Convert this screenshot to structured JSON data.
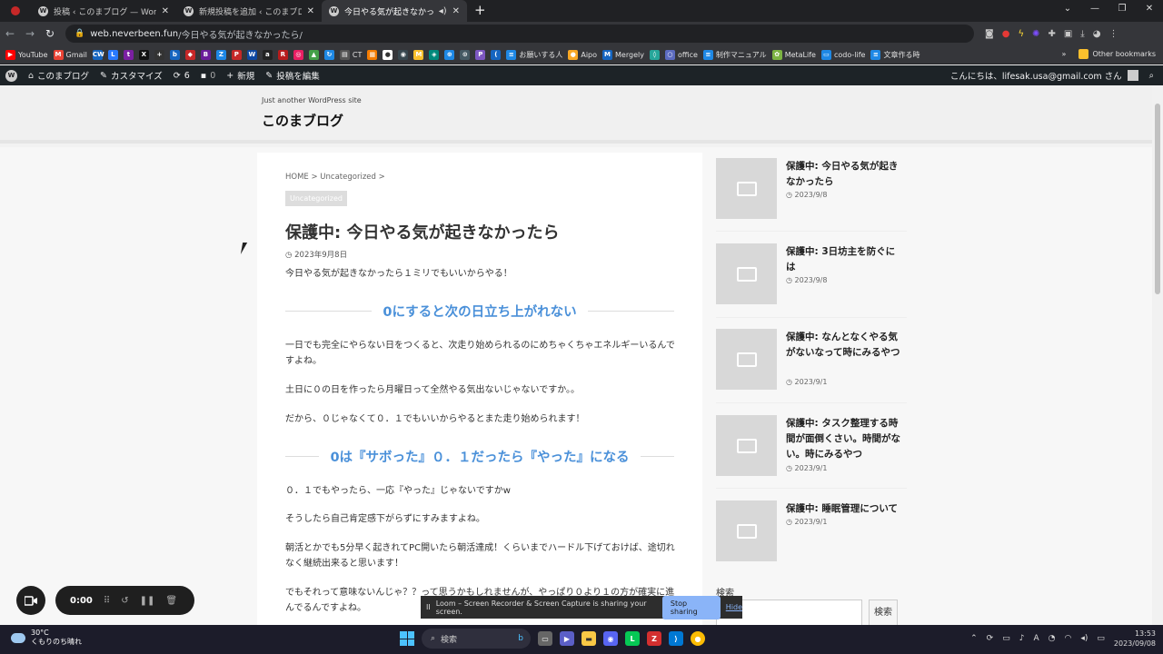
{
  "browser": {
    "tabs": [
      {
        "label": "投稿 ‹ このまブログ — WordPress"
      },
      {
        "label": "新規投稿を追加 ‹ このまブログ — W"
      },
      {
        "label": "今日やる気が起きなかったら - こ"
      }
    ],
    "url_domain": "web.neverbeen.fun",
    "url_path": "/今日やる気が起きなかったら/",
    "bookmarks": [
      {
        "label": "YouTube",
        "color": "#ff0000",
        "glyph": "▶"
      },
      {
        "label": "Gmail",
        "color": "#ea4335",
        "glyph": "M"
      },
      {
        "label": "",
        "color": "#1565c0",
        "glyph": "CW"
      },
      {
        "label": "",
        "color": "#2979ff",
        "glyph": "L"
      },
      {
        "label": "",
        "color": "#7b1fa2",
        "glyph": "t"
      },
      {
        "label": "",
        "color": "#111111",
        "glyph": "X"
      },
      {
        "label": "",
        "color": "#333333",
        "glyph": "+"
      },
      {
        "label": "",
        "color": "#1565c0",
        "glyph": "b"
      },
      {
        "label": "",
        "color": "#c62828",
        "glyph": "◆"
      },
      {
        "label": "",
        "color": "#6a1b9a",
        "glyph": "B"
      },
      {
        "label": "",
        "color": "#1e88e5",
        "glyph": "Z"
      },
      {
        "label": "",
        "color": "#c62828",
        "glyph": "P"
      },
      {
        "label": "",
        "color": "#0d47a1",
        "glyph": "W"
      },
      {
        "label": "",
        "color": "#222222",
        "glyph": "a"
      },
      {
        "label": "",
        "color": "#b71c1c",
        "glyph": "R"
      },
      {
        "label": "",
        "color": "#e91e63",
        "glyph": "◎"
      },
      {
        "label": "",
        "color": "#43a047",
        "glyph": "▲"
      },
      {
        "label": "",
        "color": "#1e88e5",
        "glyph": "↻"
      },
      {
        "label": "CT",
        "color": "#555555",
        "glyph": "▤"
      },
      {
        "label": "",
        "color": "#f57c00",
        "glyph": "▦"
      },
      {
        "label": "",
        "color": "#ffffff",
        "glyph": "●"
      },
      {
        "label": "",
        "color": "#37474f",
        "glyph": "◉"
      },
      {
        "label": "",
        "color": "#fbc02d",
        "glyph": "M"
      },
      {
        "label": "",
        "color": "#00897b",
        "glyph": "◈"
      },
      {
        "label": "",
        "color": "#1e88e5",
        "glyph": "⊕"
      },
      {
        "label": "",
        "color": "#455a64",
        "glyph": "⊙"
      },
      {
        "label": "",
        "color": "#7e57c2",
        "glyph": "P"
      },
      {
        "label": "",
        "color": "#1565c0",
        "glyph": "("
      },
      {
        "label": "お願いする人",
        "color": "#1e88e5",
        "glyph": "≡"
      },
      {
        "label": "Aipo",
        "color": "#f9a825",
        "glyph": "●"
      },
      {
        "label": "Mergely",
        "color": "#1565c0",
        "glyph": "M"
      },
      {
        "label": "",
        "color": "#26a69a",
        "glyph": "◊"
      },
      {
        "label": "office",
        "color": "#5c6bc0",
        "glyph": "○"
      },
      {
        "label": "制作マニュアル",
        "color": "#1e88e5",
        "glyph": "≡"
      },
      {
        "label": "MetaLife",
        "color": "#7cb342",
        "glyph": "✿"
      },
      {
        "label": "codo-life",
        "color": "#1e88e5",
        "glyph": "▭"
      },
      {
        "label": "文章作る時",
        "color": "#1e88e5",
        "glyph": "≡"
      }
    ],
    "other_bookmarks": "Other bookmarks"
  },
  "adminbar": {
    "site": "このまブログ",
    "customize": "カスタマイズ",
    "updates": "6",
    "comments": "0",
    "new": "新規",
    "edit": "投稿を編集",
    "greeting": "こんにちは、lifesak.usa@gmail.com さん"
  },
  "header": {
    "tagline": "Just another WordPress site",
    "site_title": "このまブログ"
  },
  "article": {
    "breadcrumb": "HOME > Uncategorized >",
    "category": "Uncategorized",
    "title": "保護中: 今日やる気が起きなかったら",
    "date": "2023年9月8日",
    "intro": "今日やる気が起きなかったら１ミリでもいいからやる！",
    "h2_1": "0にすると次の日立ち上がれない",
    "p1": "一日でも完全にやらない日をつくると、次走り始められるのにめちゃくちゃエネルギーいるんですよね。",
    "p2": "土日に０の日を作ったら月曜日って全然やる気出ないじゃないですか。。",
    "p3": "だから、０じゃなくて０．１でもいいからやるとまた走り始められます！",
    "h2_2": "0は『サボった』０．１だったら『やった』になる",
    "p4": "０．１でもやったら、一応『やった』じゃないですかw",
    "p5": "そうしたら自己肯定感下がらずにすみますよね。",
    "p6": "朝活とかでも5分早く起きれてPC開いたら朝活達成！くらいまでハードル下げておけば、途切れなく継続出来ると思います！",
    "p7": "でもそれって意味ないんじゃ？？って思うかもしれませんが、やっぱり０より１の方が確実に進んでるんですよね。"
  },
  "sidebar": {
    "posts": [
      {
        "title": "保護中: 今日やる気が起きなかったら",
        "date": "2023/9/8"
      },
      {
        "title": "保護中: 3日坊主を防ぐには",
        "date": "2023/9/8"
      },
      {
        "title": "保護中: なんとなくやる気がないなって時にみるやつ",
        "date": "2023/9/1"
      },
      {
        "title": "保護中: タスク整理する時間が面倒くさい。時間がない。時にみるやつ",
        "date": "2023/9/1"
      },
      {
        "title": "保護中: 睡眠管理について",
        "date": "2023/9/1"
      }
    ],
    "search_label": "検索",
    "search_button": "検索"
  },
  "loom": {
    "timer": "0:00",
    "share_text": "Loom – Screen Recorder & Screen Capture is sharing your screen.",
    "stop": "Stop sharing",
    "hide": "Hide"
  },
  "taskbar": {
    "temp": "30°C",
    "weather": "くもりのち晴れ",
    "search": "検索",
    "time": "13:53",
    "date": "2023/09/08"
  }
}
